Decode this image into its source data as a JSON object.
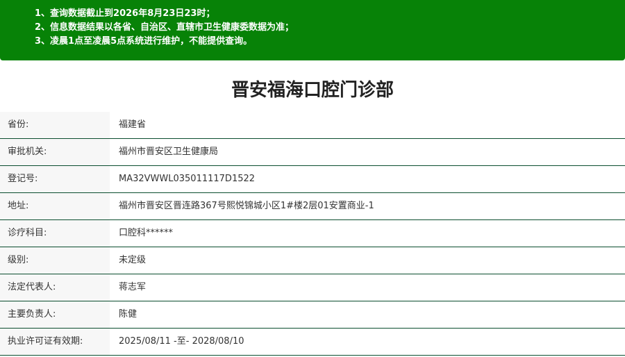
{
  "notice": {
    "lines": [
      "1、查询数据截止到2026年8月23日23时；",
      "2、信息数据结果以各省、自治区、直辖市卫生健康委数据为准；",
      "3、凌晨1点至凌晨5点系统进行维护，不能提供查询。"
    ]
  },
  "title": "晋安福海口腔门诊部",
  "rows": [
    {
      "label": "省份:",
      "value": "福建省"
    },
    {
      "label": "审批机关:",
      "value": "福州市晋安区卫生健康局"
    },
    {
      "label": "登记号:",
      "value": "MA32VWWL035011117D1522"
    },
    {
      "label": "地址:",
      "value": "福州市晋安区晋连路367号熙悦锦城小区1#楼2层01安置商业-1"
    },
    {
      "label": "诊疗科目:",
      "value": "口腔科******"
    },
    {
      "label": "级别:",
      "value": "未定级"
    },
    {
      "label": "法定代表人:",
      "value": "蒋志军"
    },
    {
      "label": "主要负责人:",
      "value": "陈健"
    },
    {
      "label": "执业许可证有效期:",
      "value": "2025/08/11 -至- 2028/08/10"
    }
  ],
  "colors": {
    "notice_bg": "#078207",
    "row_border": "#0a4d2e",
    "label_bg": "#f7f7f7"
  }
}
